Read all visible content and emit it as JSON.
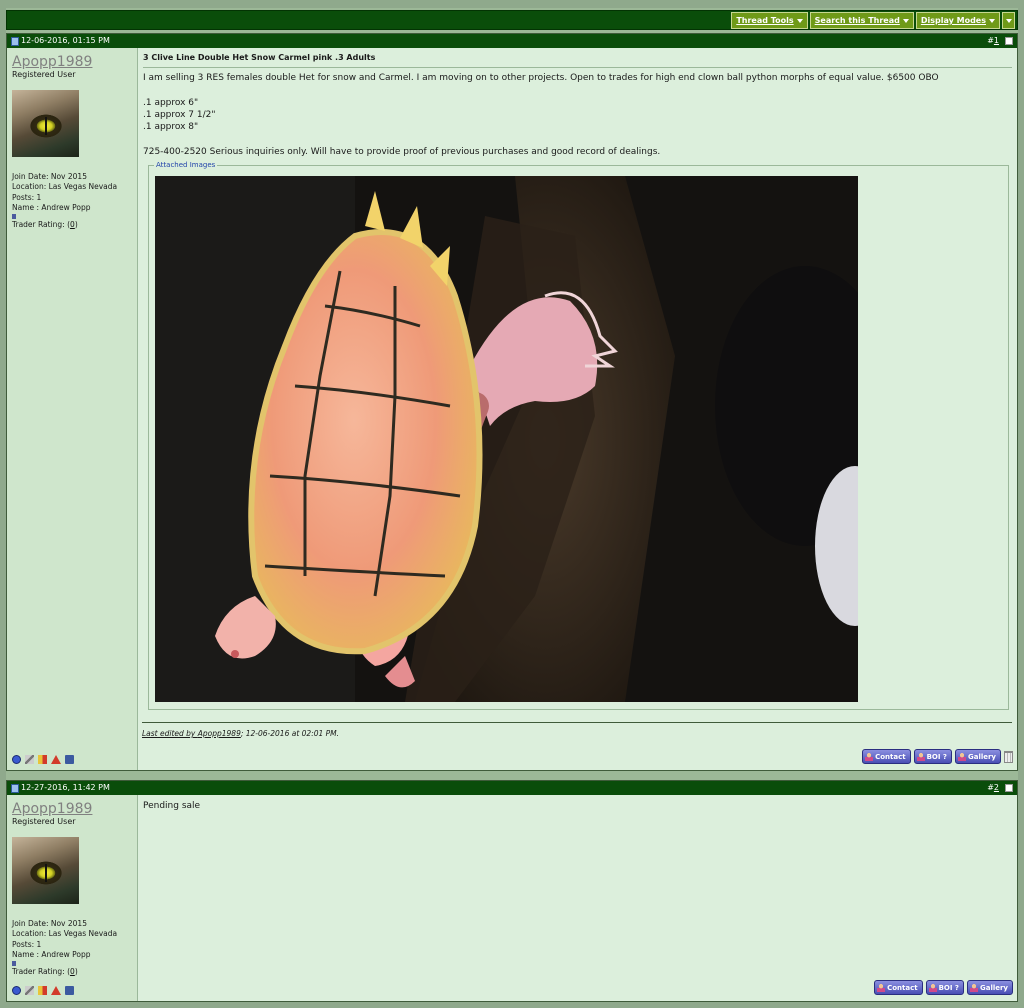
{
  "thread_tools": {
    "thread_tools_label": "Thread Tools",
    "search_thread_label": "Search this Thread",
    "display_modes_label": "Display Modes"
  },
  "posts": [
    {
      "date": "12-06-2016, 01:15 PM",
      "number": "1",
      "username": "Apopp1989",
      "user_title": "Registered User",
      "join_date": "Join Date: Nov 2015",
      "location": "Location: Las Vegas Nevada",
      "posts": "Posts: 1",
      "name": "Name : Andrew Popp",
      "trader_rating_label": "Trader Rating: (",
      "trader_rating_value": "0",
      "trader_rating_close": ")",
      "title": "3 Clive Line Double Het Snow Carmel pink .3 Adults",
      "message": "I am selling 3 RES females double Het for snow and Carmel. I am moving on to other projects. Open to trades for high end clown ball python morphs of equal value. $6500 OBO\n\n.1 approx 6\"\n.1 approx 7 1/2\"\n.1 approx 8\"\n\n725-400-2520 Serious inquiries only. Will have to provide proof of previous purchases and good record of dealings.",
      "attached_images_label": "Attached Images",
      "edited_prefix": "Last edited by ",
      "edited_by": "Apopp1989",
      "edited_suffix": "; 12-06-2016 at 02:01 PM."
    },
    {
      "date": "12-27-2016, 11:42 PM",
      "number": "2",
      "username": "Apopp1989",
      "user_title": "Registered User",
      "join_date": "Join Date: Nov 2015",
      "location": "Location: Las Vegas Nevada",
      "posts": "Posts: 1",
      "name": "Name : Andrew Popp",
      "trader_rating_label": "Trader Rating: (",
      "trader_rating_value": "0",
      "trader_rating_close": ")",
      "message": "Pending sale"
    }
  ],
  "post_buttons": {
    "contact": "Contact",
    "boi": "BOI ?",
    "gallery": "Gallery"
  },
  "colors": {
    "header_green": "#0a4d0a",
    "toolbar_button": "#6f9a18",
    "post_background": "#dcefdc",
    "user_column": "#cfe6cc"
  }
}
